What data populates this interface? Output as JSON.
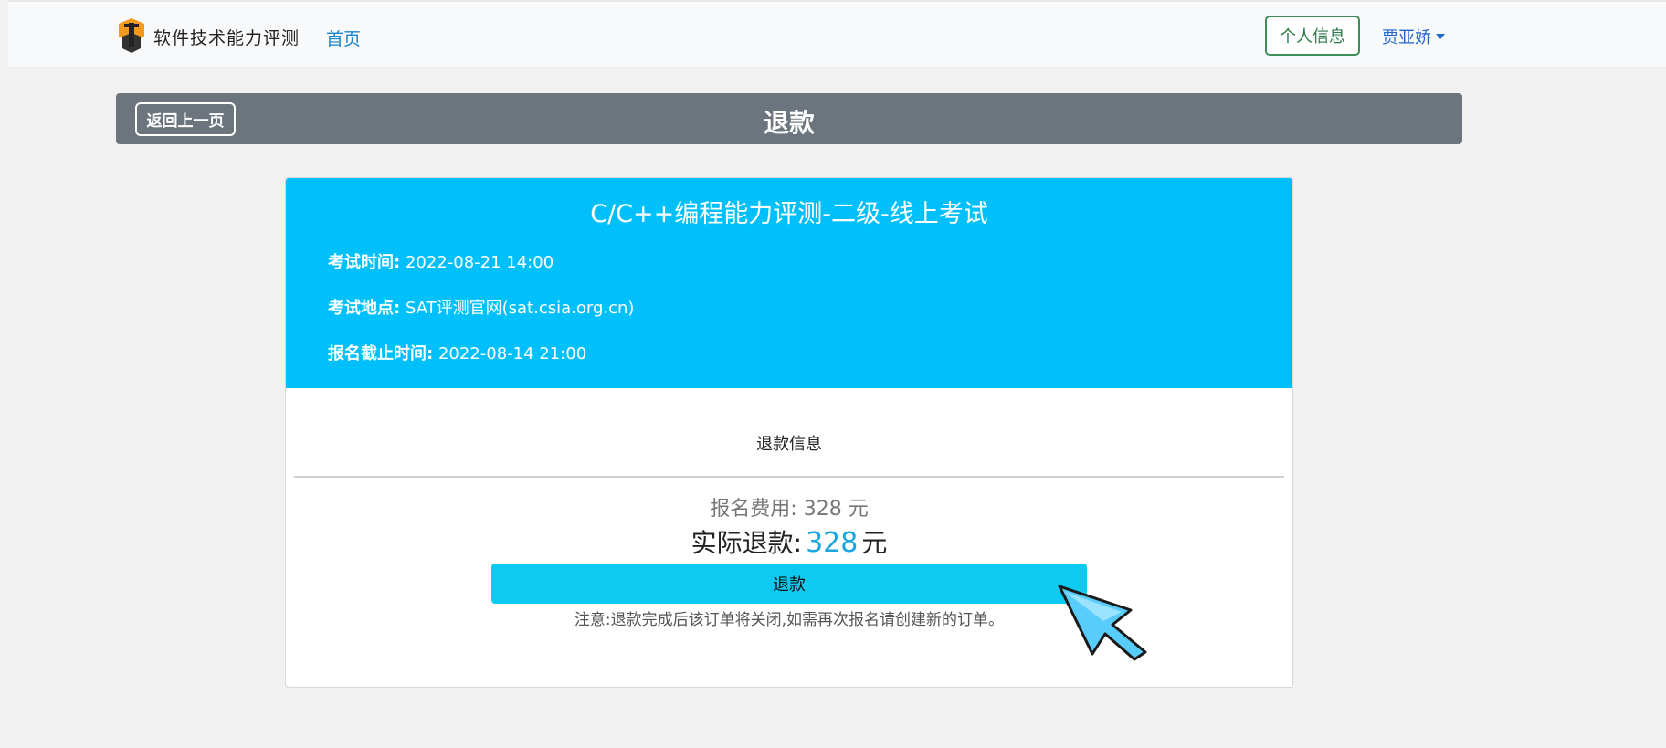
{
  "nav": {
    "brand": "软件技术能力评测",
    "home": "首页",
    "profile_button": "个人信息",
    "user_name": "贾亚娇"
  },
  "title_bar": {
    "back_button": "返回上一页",
    "title": "退款"
  },
  "exam": {
    "name": "C/C++编程能力评测-二级-线上考试",
    "time_label": "考试时间:",
    "time_value": "2022-08-21 14:00",
    "location_label": "考试地点:",
    "location_value": "SAT评测官网(sat.csia.org.cn)",
    "deadline_label": "报名截止时间:",
    "deadline_value": "2022-08-14 21:00"
  },
  "refund": {
    "section_title": "退款信息",
    "fee_label": "报名费用:",
    "fee_value": "328 元",
    "actual_label": "实际退款:",
    "actual_value": "328",
    "actual_unit": "元",
    "button": "退款",
    "note": "注意:退款完成后该订单将关闭,如需再次报名请创建新的订单。"
  },
  "colors": {
    "header_blue": "#00c0fb",
    "refund_button": "#0ecaf0",
    "title_bar": "#6c757d"
  }
}
